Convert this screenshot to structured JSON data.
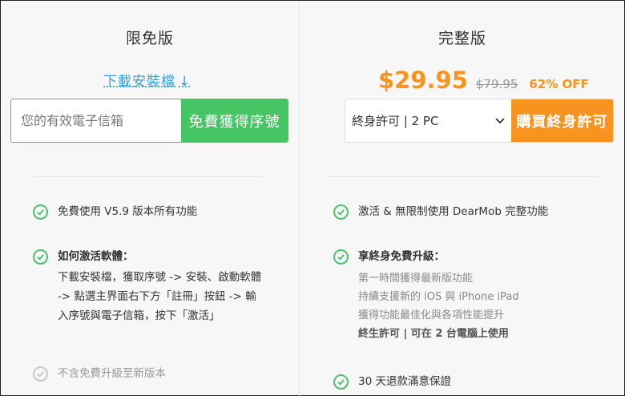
{
  "free": {
    "title": "限免版",
    "download_link": "下載安裝檔",
    "download_arrow": "↓",
    "email_placeholder": "您的有效電子信箱",
    "get_serial_button": "免費獲得序號",
    "features": {
      "f1": "免費使用 V5.9 版本所有功能",
      "f2_title": "如何激活軟體：",
      "f2_desc": "下載安裝檔，獲取序號 -> 安裝、啟動軟體 -> 點選主界面右下方「註冊」按鈕 -> 輸入序號與電子信箱，按下「激活」",
      "f3": "不含免費升級至新版本"
    }
  },
  "full": {
    "title": "完整版",
    "price": "$29.95",
    "old_price": "$79.95",
    "discount": "62% OFF",
    "license_selected": "終身許可 | 2 PC",
    "buy_button": "購買終身許可",
    "features": {
      "f1": "激活 & 無限制使用 DearMob 完整功能",
      "f2_title": "享終身免費升級：",
      "f2_items": [
        "第一時間獲得最新版功能",
        "持續支援新的 iOS 與 iPhone iPad",
        "獲得功能最佳化與各項性能提升",
        "終生許可 | 可在 2 台電腦上使用"
      ],
      "f3": "30 天退款滿意保證"
    }
  },
  "colors": {
    "green": "#46c564",
    "orange": "#f7931e",
    "link_blue": "#3aa0d8"
  },
  "icons": {
    "check": "check-circle-icon",
    "dropdown": "chevron-down-icon"
  }
}
